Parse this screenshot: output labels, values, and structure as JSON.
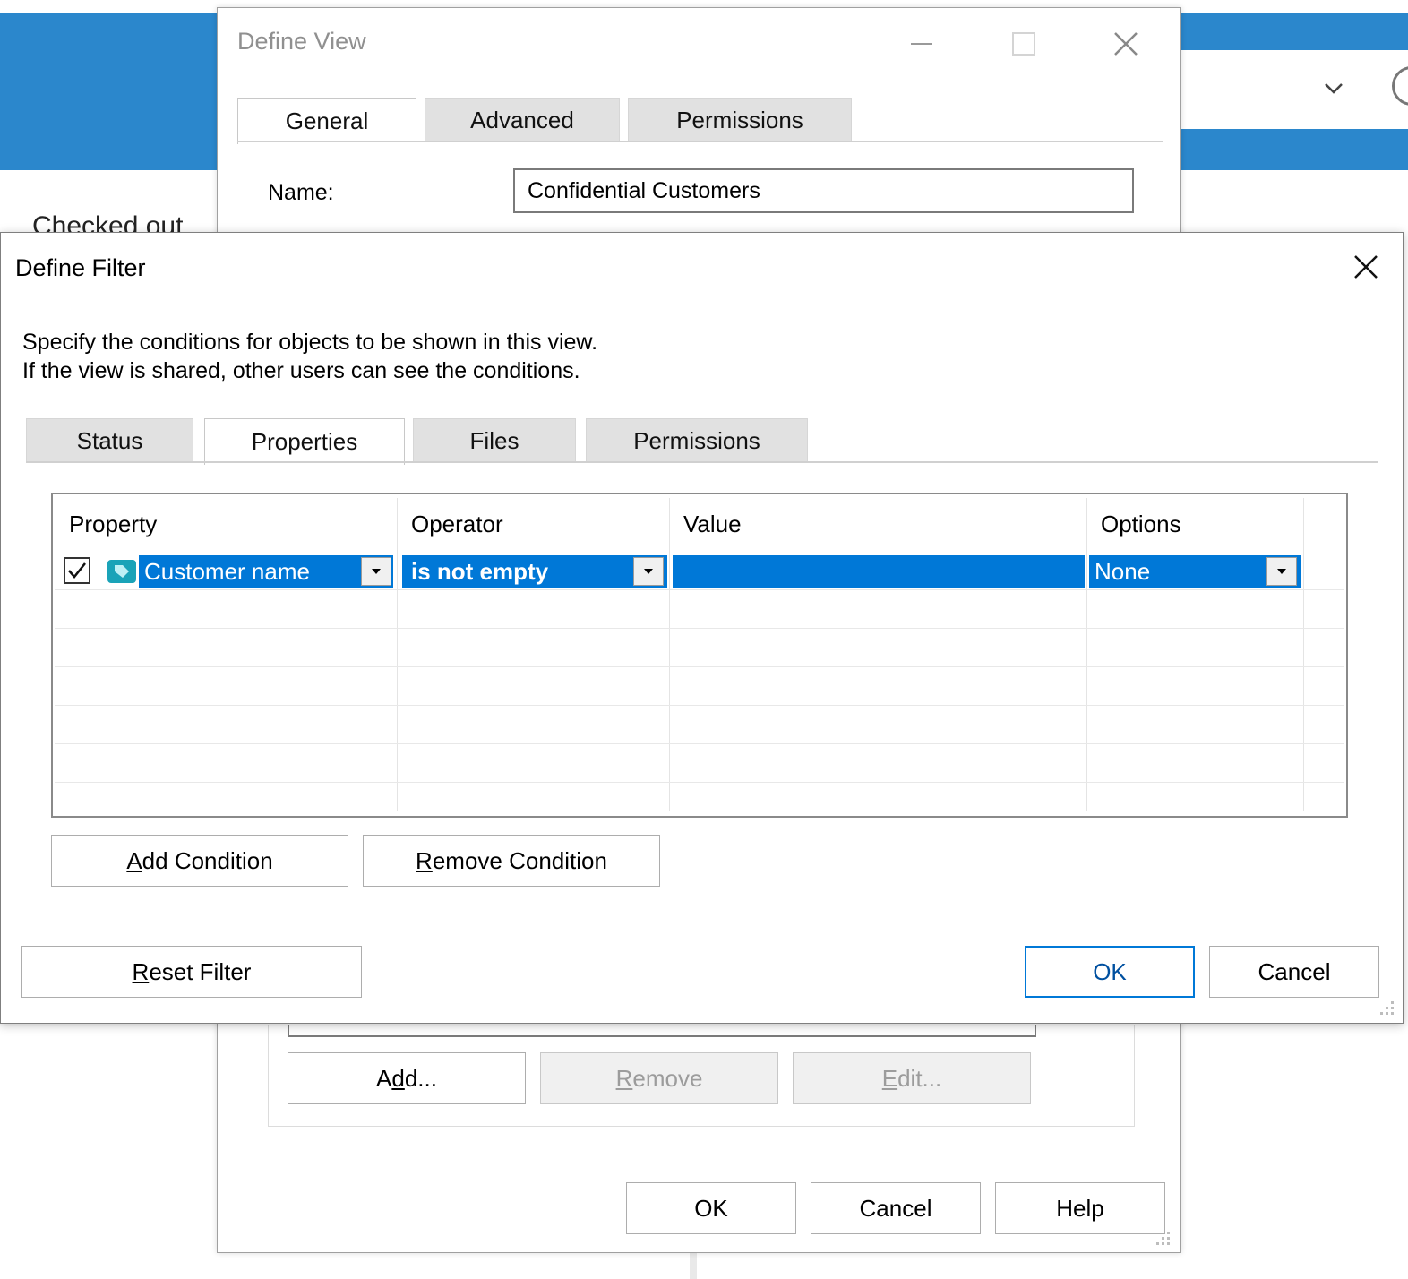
{
  "background": {
    "partial_text": "Checked out",
    "accent_color": "#2b87cc"
  },
  "define_view": {
    "title": "Define View",
    "tabs": [
      {
        "label": "General",
        "active": true
      },
      {
        "label": "Advanced",
        "active": false
      },
      {
        "label": "Permissions",
        "active": false
      }
    ],
    "name_label": "Name:",
    "name_value": "Confidential Customers",
    "list_buttons": {
      "add": {
        "pre": "A",
        "ul": "d",
        "post": "d..."
      },
      "remove": {
        "pre": "",
        "ul": "R",
        "post": "emove"
      },
      "edit": {
        "pre": "",
        "ul": "E",
        "post": "dit..."
      }
    },
    "ok_label": "OK",
    "cancel_label": "Cancel",
    "help_label": "Help"
  },
  "define_filter": {
    "title": "Define Filter",
    "description_line1": "Specify the conditions for objects to be shown in this view.",
    "description_line2": "If the view is shared, other users can see the conditions.",
    "tabs": [
      {
        "label": "Status",
        "active": false
      },
      {
        "label": "Properties",
        "active": true
      },
      {
        "label": "Files",
        "active": false
      },
      {
        "label": "Permissions",
        "active": false
      }
    ],
    "grid": {
      "columns": [
        "Property",
        "Operator",
        "Value",
        "Options"
      ],
      "rows": [
        {
          "checked": true,
          "property": "Customer name",
          "operator": "is not empty",
          "value": "",
          "options": "None"
        }
      ]
    },
    "add_condition": {
      "pre": "",
      "ul": "A",
      "post": "dd Condition"
    },
    "remove_condition": {
      "pre": "",
      "ul": "R",
      "post": "emove Condition"
    },
    "reset_filter": {
      "pre": "",
      "ul": "R",
      "post": "eset Filter"
    },
    "ok_label": "OK",
    "cancel_label": "Cancel",
    "selection_color": "#0078d7",
    "icons": [
      "chevron-down-icon",
      "minimize-icon",
      "maximize-icon",
      "close-icon",
      "property-tag-icon",
      "dropdown-arrow-icon",
      "resize-grip-icon",
      "checkbox-checked-icon"
    ]
  }
}
